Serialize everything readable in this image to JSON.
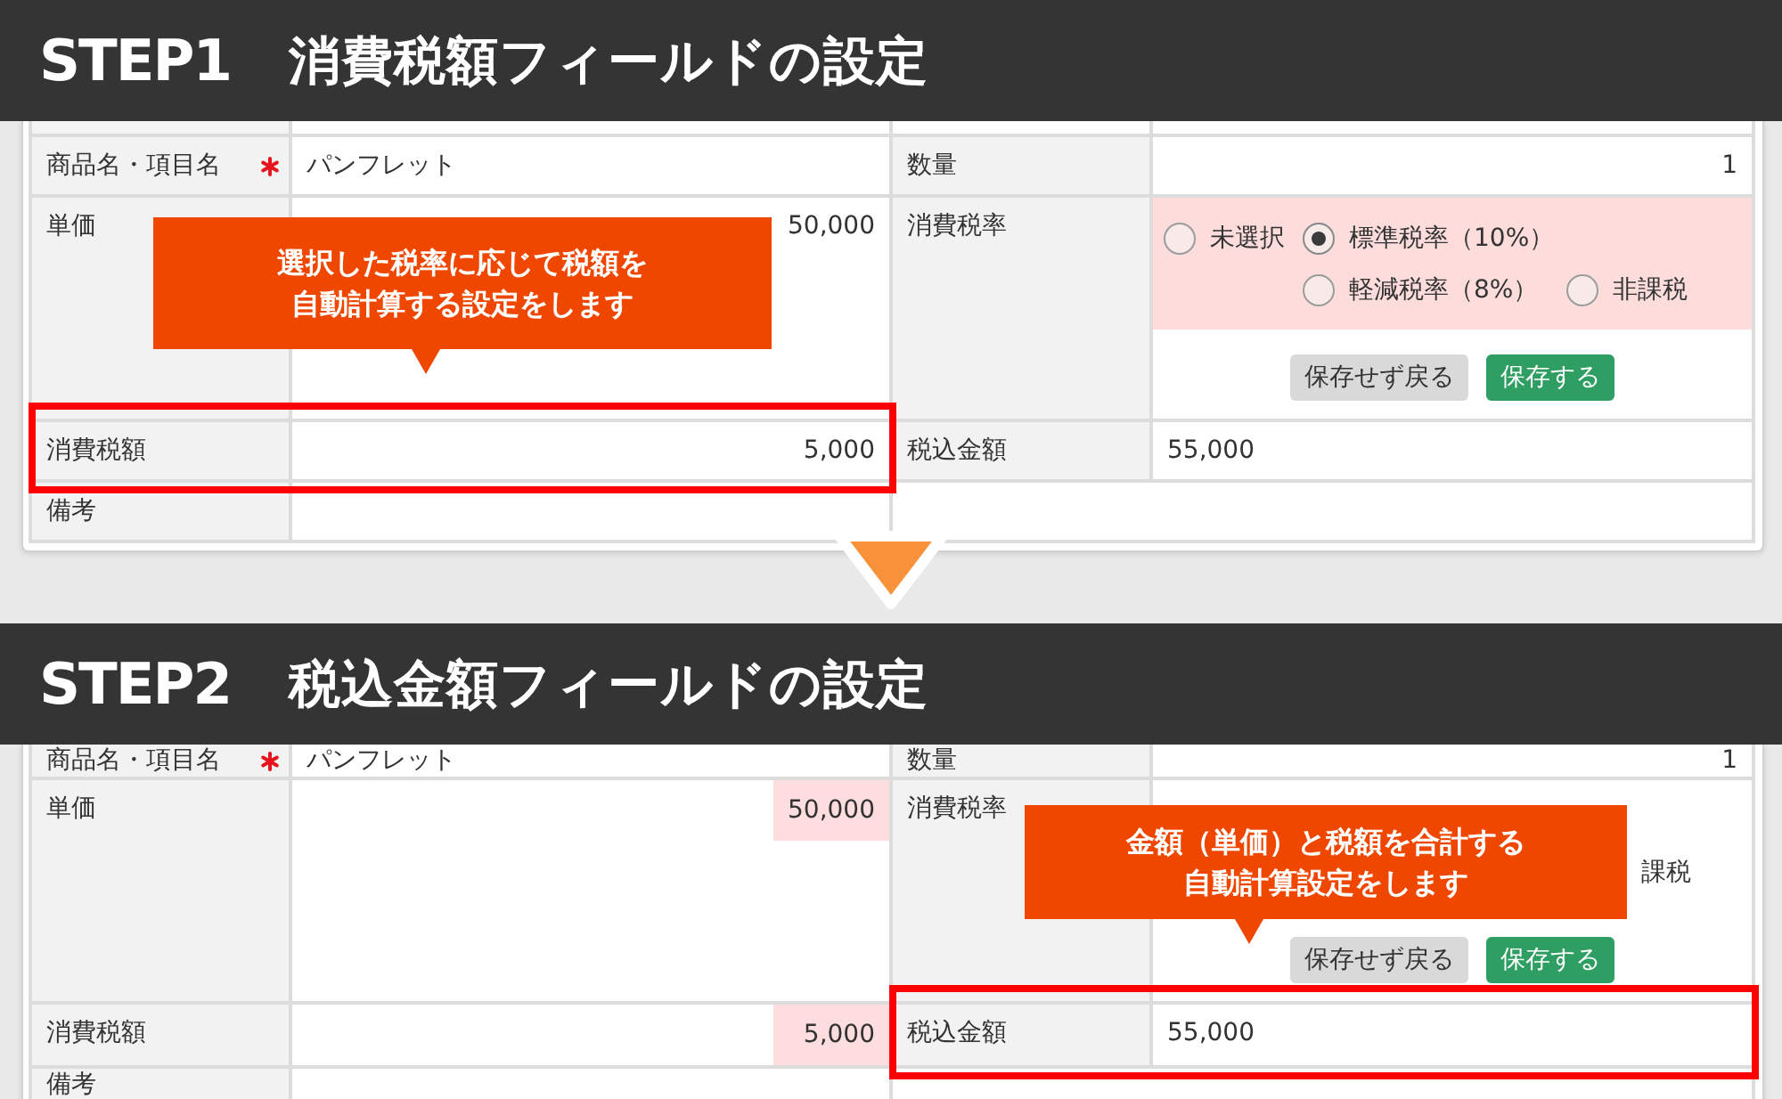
{
  "steps": [
    {
      "step_label": "STEP1",
      "title": "消費税額フィールドの設定",
      "rows": [
        {
          "left": {
            "kind": "text",
            "label": "商品名・項目名",
            "required": true,
            "value": "パンフレット",
            "highlighted": false,
            "framed": false
          },
          "right": {
            "kind": "number",
            "label": "数量",
            "required": false,
            "value": "1",
            "highlighted": false,
            "framed": false
          }
        },
        {
          "left": {
            "kind": "number",
            "label": "単価",
            "required": false,
            "value": "50,000",
            "highlighted": false,
            "framed": false
          },
          "right": {
            "kind": "radio_group",
            "label": "消費税率",
            "required": false,
            "highlighted": true,
            "framed": false,
            "options": [
              {
                "label": "未選択",
                "selected": false
              },
              {
                "label": "標準税率（10%）",
                "selected": true
              },
              {
                "label": "軽減税率（8%）",
                "selected": false
              },
              {
                "label": "非課税",
                "selected": false
              }
            ],
            "buttons": [
              {
                "label": "保存せず戻る",
                "kind": "secondary"
              },
              {
                "label": "保存する",
                "kind": "primary"
              }
            ]
          }
        },
        {
          "left": {
            "kind": "number",
            "label": "消費税額",
            "required": false,
            "value": "5,000",
            "highlighted": false,
            "framed": true
          },
          "right": {
            "kind": "text",
            "label": "税込金額",
            "required": false,
            "value": "55,000",
            "highlighted": false,
            "framed": false
          }
        },
        {
          "left": {
            "kind": "text",
            "label": "備考",
            "required": false,
            "framed": false
          }
        }
      ],
      "callout": {
        "text": "選択した税率に応じて税額を自動計算する設定をします"
      }
    },
    {
      "step_label": "STEP2",
      "title": "税込金額フィールドの設定",
      "rows": [
        {
          "left": {
            "kind": "text",
            "label": "商品名・項目名",
            "required": true,
            "value": "パンフレット",
            "highlighted": false,
            "framed": false
          },
          "right": {
            "kind": "number",
            "label": "数量",
            "required": false,
            "value": "1",
            "highlighted": false,
            "framed": false
          }
        },
        {
          "left": {
            "kind": "number",
            "label": "単価",
            "required": false,
            "value": "50,000",
            "highlighted": true,
            "framed": false
          },
          "right": {
            "kind": "covered",
            "label": "消費税率",
            "required": false,
            "highlighted": false,
            "framed": false,
            "visible_text": "課税",
            "buttons": [
              {
                "label": "保存せず戻る",
                "kind": "secondary"
              },
              {
                "label": "保存する",
                "kind": "primary"
              }
            ]
          }
        },
        {
          "left": {
            "kind": "number",
            "label": "消費税額",
            "required": false,
            "value": "5,000",
            "highlighted": true,
            "framed": false
          },
          "right": {
            "kind": "text",
            "label": "税込金額",
            "required": false,
            "value": "55,000",
            "highlighted": false,
            "framed": true
          }
        },
        {
          "left": {
            "kind": "text",
            "label": "備考",
            "required": false,
            "framed": false
          }
        }
      ],
      "callout": {
        "text": "金額（単価）と税額を合計する自動計算設定をします"
      }
    }
  ]
}
